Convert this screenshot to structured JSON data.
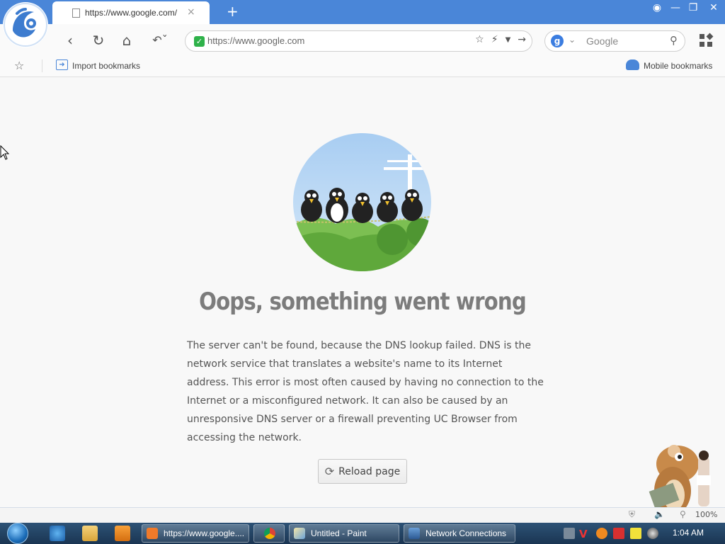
{
  "browser": {
    "tab_title": "https://www.google.com/",
    "tab_close": "×",
    "new_tab": "+",
    "url": "https://www.google.com",
    "search_engine_letter": "g",
    "search_placeholder": "Google",
    "accent_color": "#4a86d8"
  },
  "bookmarks": {
    "import_label": "Import bookmarks",
    "mobile_label": "Mobile bookmarks"
  },
  "error": {
    "title": "Oops, something went wrong",
    "description": "The server can't be found, because the DNS lookup failed. DNS is the network service that translates a website's name to its Internet address. This error is most often caused by having no connection to the Internet or a misconfigured network. It can also be caused by an unresponsive DNS server or a firewall preventing UC Browser from accessing the network.",
    "reload_label": "Reload page"
  },
  "statusbar": {
    "zoom": "100%"
  },
  "taskbar": {
    "tasks": [
      {
        "label": "https://www.google...."
      },
      {
        "label": ""
      },
      {
        "label": "Untitled - Paint"
      },
      {
        "label": "Network Connections"
      }
    ],
    "clock": "1:04 AM"
  }
}
